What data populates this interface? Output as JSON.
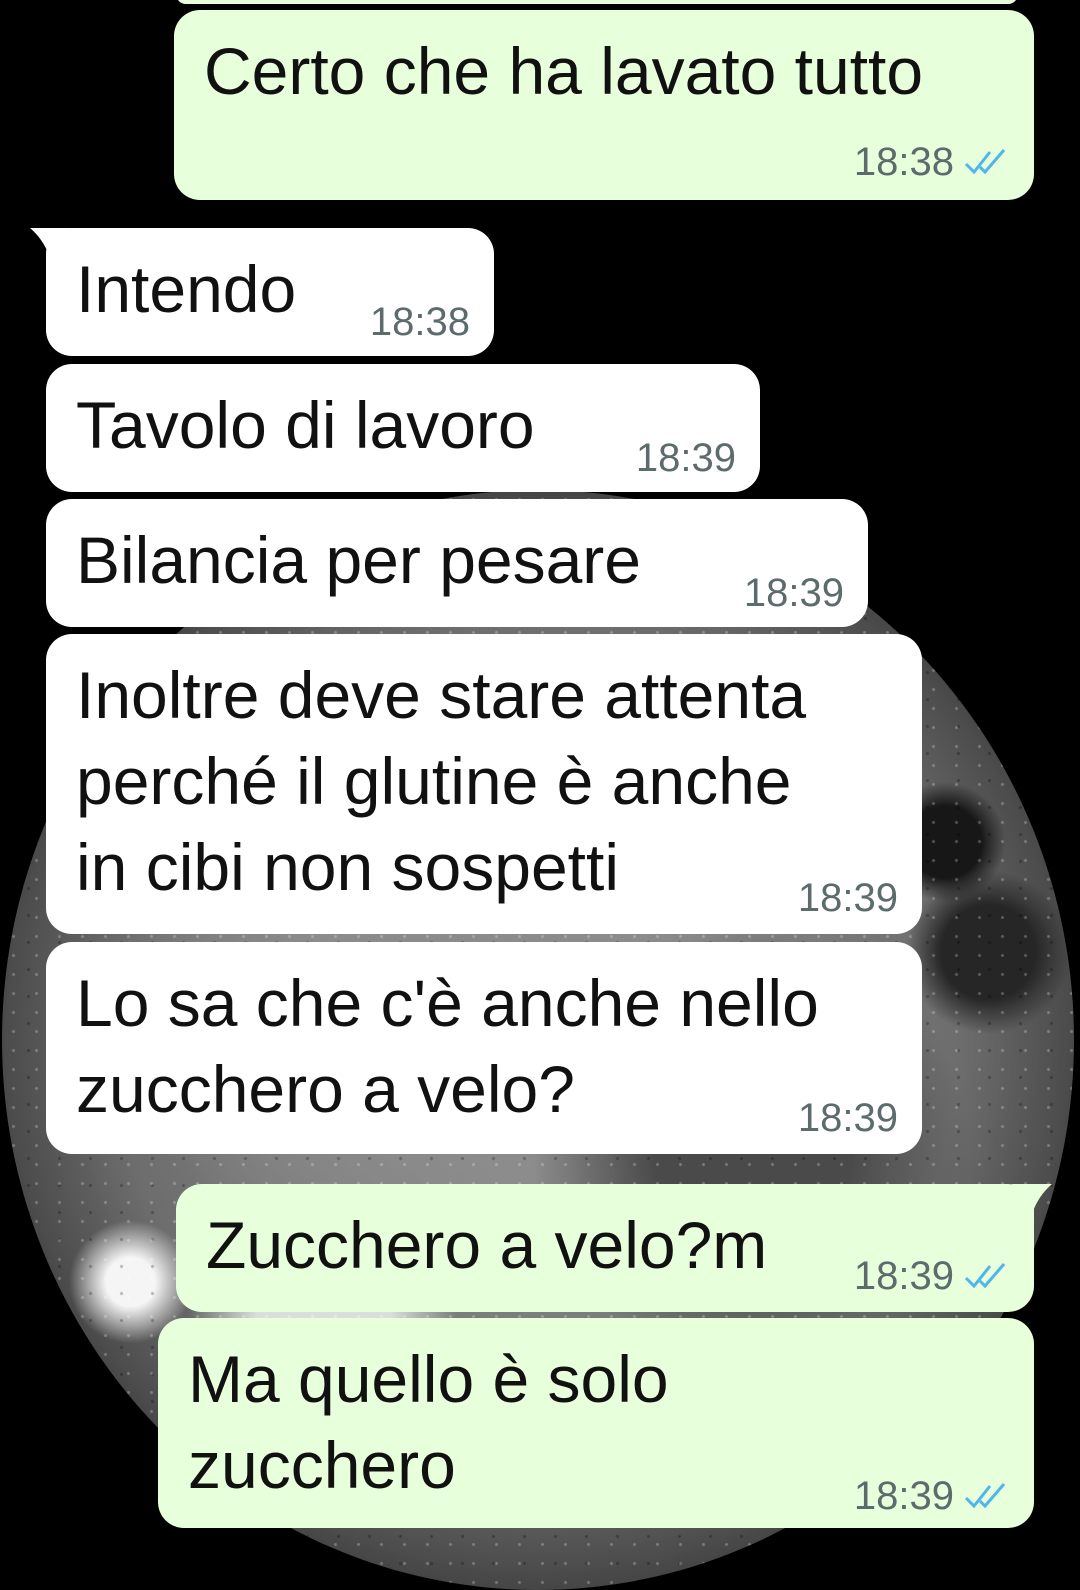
{
  "messages": [
    {
      "direction": "out",
      "text": "Certo che ha lavato tutto",
      "time": "18:38",
      "status": "read-icon"
    },
    {
      "direction": "in",
      "text": "Intendo",
      "time": "18:38"
    },
    {
      "direction": "in",
      "text": "Tavolo di lavoro",
      "time": "18:39"
    },
    {
      "direction": "in",
      "text": "Bilancia per pesare",
      "time": "18:39"
    },
    {
      "direction": "in",
      "text": "Inoltre deve stare attenta\nperché il glutine è anche\nin cibi non sospetti",
      "time": "18:39"
    },
    {
      "direction": "in",
      "text": "Lo sa che c'è anche nello\nzucchero a velo?",
      "time": "18:39"
    },
    {
      "direction": "out",
      "text": "Zucchero a velo?m",
      "time": "18:39",
      "status": "read-icon"
    },
    {
      "direction": "out",
      "text": "Ma quello è solo\nzucchero",
      "time": "18:39",
      "status": "read-icon"
    }
  ],
  "colors": {
    "incoming_bubble": "#ffffff",
    "outgoing_bubble": "#e7ffdb",
    "read_ticks": "#4fb6ec",
    "timestamp": "#5d6b6d",
    "background": "#000000"
  }
}
